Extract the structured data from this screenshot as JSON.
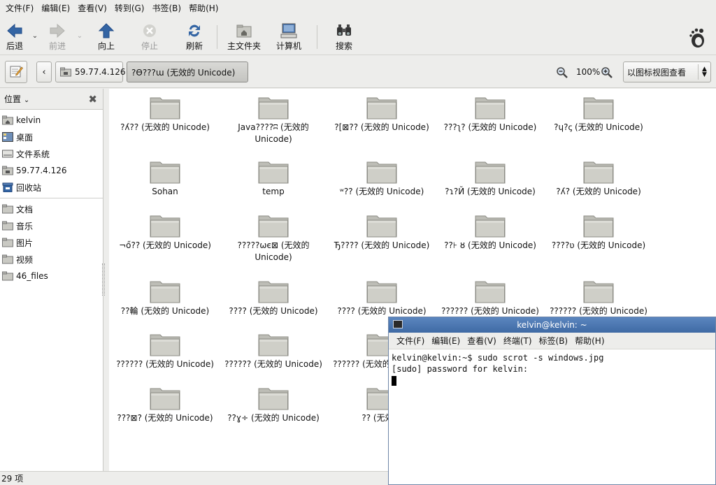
{
  "menubar": [
    "文件(F)",
    "编辑(E)",
    "查看(V)",
    "转到(G)",
    "书签(B)",
    "帮助(H)"
  ],
  "toolbar": {
    "back": "后退",
    "forward": "前进",
    "up": "向上",
    "stop": "停止",
    "reload": "刷新",
    "home": "主文件夹",
    "computer": "计算机",
    "search": "搜索"
  },
  "location": {
    "crumb_host": "59.77.4.126",
    "crumb_current": "?ϴ???ɯ (无效的 Unicode)",
    "zoom": "100%",
    "view_mode": "以图标视图查看"
  },
  "sidebar": {
    "title": "位置",
    "items": [
      {
        "label": "kelvin",
        "icon": "home-icon"
      },
      {
        "label": "桌面",
        "icon": "desktop-icon"
      },
      {
        "label": "文件系统",
        "icon": "drive-icon"
      },
      {
        "label": "59.77.4.126",
        "icon": "network-folder-icon"
      },
      {
        "label": "回收站",
        "icon": "trash-icon"
      }
    ],
    "bookmarks": [
      {
        "label": "文档"
      },
      {
        "label": "音乐"
      },
      {
        "label": "图片"
      },
      {
        "label": "视频"
      },
      {
        "label": "46_files"
      }
    ]
  },
  "files": [
    "?ʎ?? (无效的 Unicode)",
    "Java????ʭ (无效的 Unicode)",
    "?[⊠?? (无效的 Unicode)",
    "???ʅ? (无效的 Unicode)",
    "?ɥ?ꞔ (无效的 Unicode)",
    "Sohan",
    "temp",
    "ʷ?? (无效的 Unicode)",
    "?ɿ?Й (无效的 Unicode)",
    "?ʎ? (无效的 Unicode)",
    "¬ő?? (无效的 Unicode)",
    "?????ωє⊠ (无效的 Unicode)",
    "Ђ???? (无效的 Unicode)",
    "??⊦ ȣ (无效的 Unicode)",
    "????ʋ (无效的 Unicode)",
    "??輪 (无效的 Unicode)",
    "???? (无效的 Unicode)",
    "???? (无效的 Unicode)",
    "?????? (无效的 Unicode)",
    "?????? (无效的 Unicode)",
    "?????? (无效的 Unicode)",
    "?????? (无效的 Unicode)",
    "?????? (无效的 Unicode)",
    "",
    "",
    "???⊠? (无效的 Unicode)",
    "??ɣ÷ (无效的 Unicode)",
    "?? (无效的",
    "",
    ""
  ],
  "status": "29 项",
  "terminal": {
    "title": "kelvin@kelvin: ~",
    "menu": [
      "文件(F)",
      "编辑(E)",
      "查看(V)",
      "终端(T)",
      "标签(B)",
      "帮助(H)"
    ],
    "lines": [
      "kelvin@kelvin:~$ sudo scrot -s windows.jpg",
      "[sudo] password for kelvin: "
    ]
  },
  "colors": {
    "accent_blue": "#3465a4",
    "folder": "#c9c9c3",
    "terminal_title": "#4a77b2"
  }
}
